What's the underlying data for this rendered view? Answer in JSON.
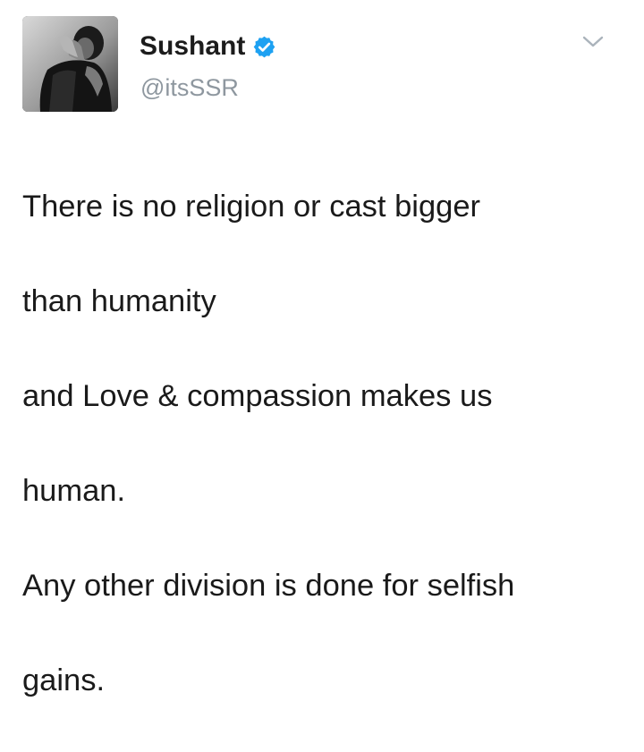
{
  "tweet": {
    "author": {
      "display_name": "Sushant",
      "handle": "@itsSSR",
      "verified": true,
      "avatar_icon": "profile-photo"
    },
    "menu_icon": "chevron-down-icon",
    "text_lines": [
      "There is no religion or cast bigger",
      "than humanity",
      "and Love & compassion makes us",
      "human.",
      "Any other division is done for selfish",
      "gains."
    ]
  },
  "colors": {
    "verified_blue": "#1da1f2",
    "handle_gray": "#8e979f",
    "text": "#1a1a1a",
    "chevron_gray": "#aab3bb"
  }
}
